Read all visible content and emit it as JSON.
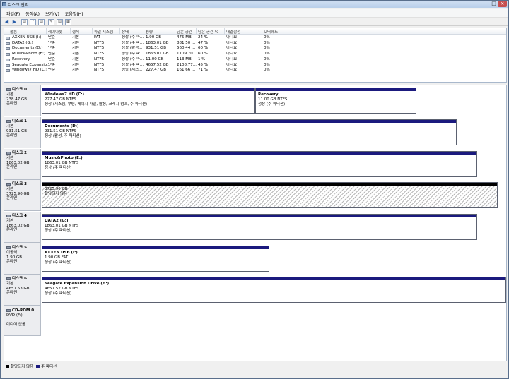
{
  "window": {
    "title": "디스크 관리"
  },
  "menu": [
    "파일(F)",
    "동작(A)",
    "보기(V)",
    "도움말(H)"
  ],
  "toolbar": {
    "back": "◀",
    "forward": "▶",
    "btn1": "▤",
    "btn2": "?",
    "btn3": "▤",
    "btn4": "✎",
    "btn5": "▤",
    "btn6": "▦"
  },
  "volume_table": {
    "headers": [
      "볼륨",
      "레이아웃",
      "형식",
      "파일 시스템",
      "상태",
      "용량",
      "남은 공간",
      "남은 공간 %",
      "내결함성",
      "오버헤드"
    ],
    "rows": [
      [
        "AXXEN USB (I:)",
        "단순",
        "기본",
        "FAT",
        "정상 (주 파...",
        "1.90 GB",
        "475 MB",
        "24 %",
        "아니요",
        "0%"
      ],
      [
        "DATA2 (G:)",
        "단순",
        "기본",
        "NTFS",
        "정상 (주 파...",
        "1863.01 GB",
        "881.50 ...",
        "47 %",
        "아니요",
        "0%"
      ],
      [
        "Documents (D:)",
        "단순",
        "기본",
        "NTFS",
        "정상 (활성...",
        "931.51 GB",
        "560.44 ...",
        "60 %",
        "아니요",
        "0%"
      ],
      [
        "Music&Photo (E:)",
        "단순",
        "기본",
        "NTFS",
        "정상 (주 파...",
        "1863.01 GB",
        "1109.70...",
        "60 %",
        "아니요",
        "0%"
      ],
      [
        "Recovery",
        "단순",
        "기본",
        "NTFS",
        "정상 (주 파...",
        "11.00 GB",
        "113 MB",
        "1 %",
        "아니요",
        "0%"
      ],
      [
        "Seagate Expansio...",
        "단순",
        "기본",
        "NTFS",
        "정상 (주 파...",
        "4657.52 GB",
        "2108.77...",
        "45 %",
        "아니요",
        "0%"
      ],
      [
        "Windows7 HD (C:)",
        "단순",
        "기본",
        "NTFS",
        "정상 (시스...",
        "227.47 GB",
        "161.66 ...",
        "71 %",
        "아니요",
        "0%"
      ]
    ]
  },
  "disks": [
    {
      "name": "디스크 0",
      "type": "기본",
      "size": "238.47 GB",
      "status": "온라인",
      "partitions": [
        {
          "name": "Windows7 HD  (C:)",
          "size": "227.47 GB NTFS",
          "status": "정상 (시스템, 부팅, 페이지 파일, 활성, 크래시 덤프, 주 파티션)"
        },
        {
          "name": "Recovery",
          "size": "11.00 GB NTFS",
          "status": "정상 (주 파티션)"
        }
      ]
    },
    {
      "name": "디스크 1",
      "type": "기본",
      "size": "931.51 GB",
      "status": "온라인",
      "partitions": [
        {
          "name": "Documents  (D:)",
          "size": "931.51 GB NTFS",
          "status": "정상 (활성, 주 파티션)"
        }
      ]
    },
    {
      "name": "디스크 2",
      "type": "기본",
      "size": "1863.02 GB",
      "status": "온라인",
      "partitions": [
        {
          "name": "Music&Photo  (E:)",
          "size": "1863.01 GB NTFS",
          "status": "정상 (주 파티션)"
        }
      ]
    },
    {
      "name": "디스크 3",
      "type": "기본",
      "size": "3725.90 GB",
      "status": "온라인",
      "partitions": [
        {
          "name": "",
          "size": "3725.90 GB",
          "status": "할당되지 않음"
        }
      ]
    },
    {
      "name": "디스크 4",
      "type": "기본",
      "size": "1863.02 GB",
      "status": "온라인",
      "partitions": [
        {
          "name": "DATA2  (G:)",
          "size": "1863.01 GB NTFS",
          "status": "정상 (주 파티션)"
        }
      ]
    },
    {
      "name": "디스크 5",
      "type": "이동식",
      "size": "1.90 GB",
      "status": "온라인",
      "partitions": [
        {
          "name": "AXXEN USB  (I:)",
          "size": "1.90 GB FAT",
          "status": "정상 (주 파티션)"
        }
      ]
    },
    {
      "name": "디스크 6",
      "type": "기본",
      "size": "4657.53 GB",
      "status": "온라인",
      "partitions": [
        {
          "name": "Seagate Expansion Drive  (H:)",
          "size": "4657.52 GB NTFS",
          "status": "정상 (주 파티션)"
        }
      ]
    },
    {
      "name": "CD-ROM 0",
      "type": "DVD (F:)",
      "size": "",
      "status": "미디어 없음",
      "partitions": []
    }
  ],
  "legend": {
    "unallocated": "할당되지 않음",
    "primary": "주 파티션",
    "unallocated_color": "#000000",
    "primary_color": "#1b1a7e"
  }
}
